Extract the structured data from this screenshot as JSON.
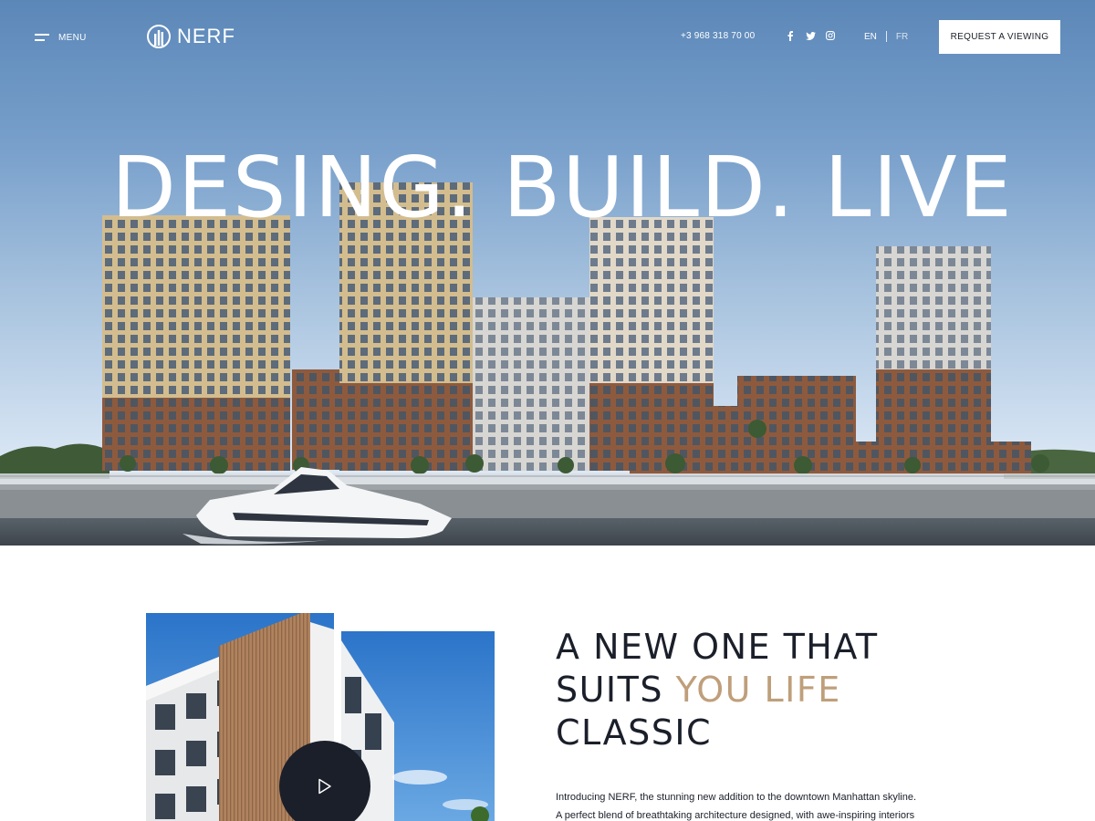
{
  "header": {
    "menu_label": "MENU",
    "logo_text": "NERF",
    "phone": "+3 968 318 70 00",
    "socials": [
      "facebook-icon",
      "twitter-icon",
      "instagram-icon"
    ],
    "languages": {
      "active": "EN",
      "other": "FR"
    },
    "cta_label": "REQUEST A VIEWING"
  },
  "hero": {
    "headline": "DESING. BUILD. LIVE"
  },
  "intro": {
    "title_line1": "A NEW ONE THAT",
    "title_line2_plain": "SUITS ",
    "title_line2_accent": "YOU LIFE",
    "title_line3": "CLASSIC",
    "paragraph_line1": "Introducing NERF, the stunning new addition to the downtown Manhattan skyline.",
    "paragraph_line2": "A perfect blend of breathtaking architecture designed, with awe-inspiring interiors"
  },
  "colors": {
    "accent": "#bf9f7a",
    "dark": "#1b1f2a",
    "sky": "#6f98c6"
  }
}
